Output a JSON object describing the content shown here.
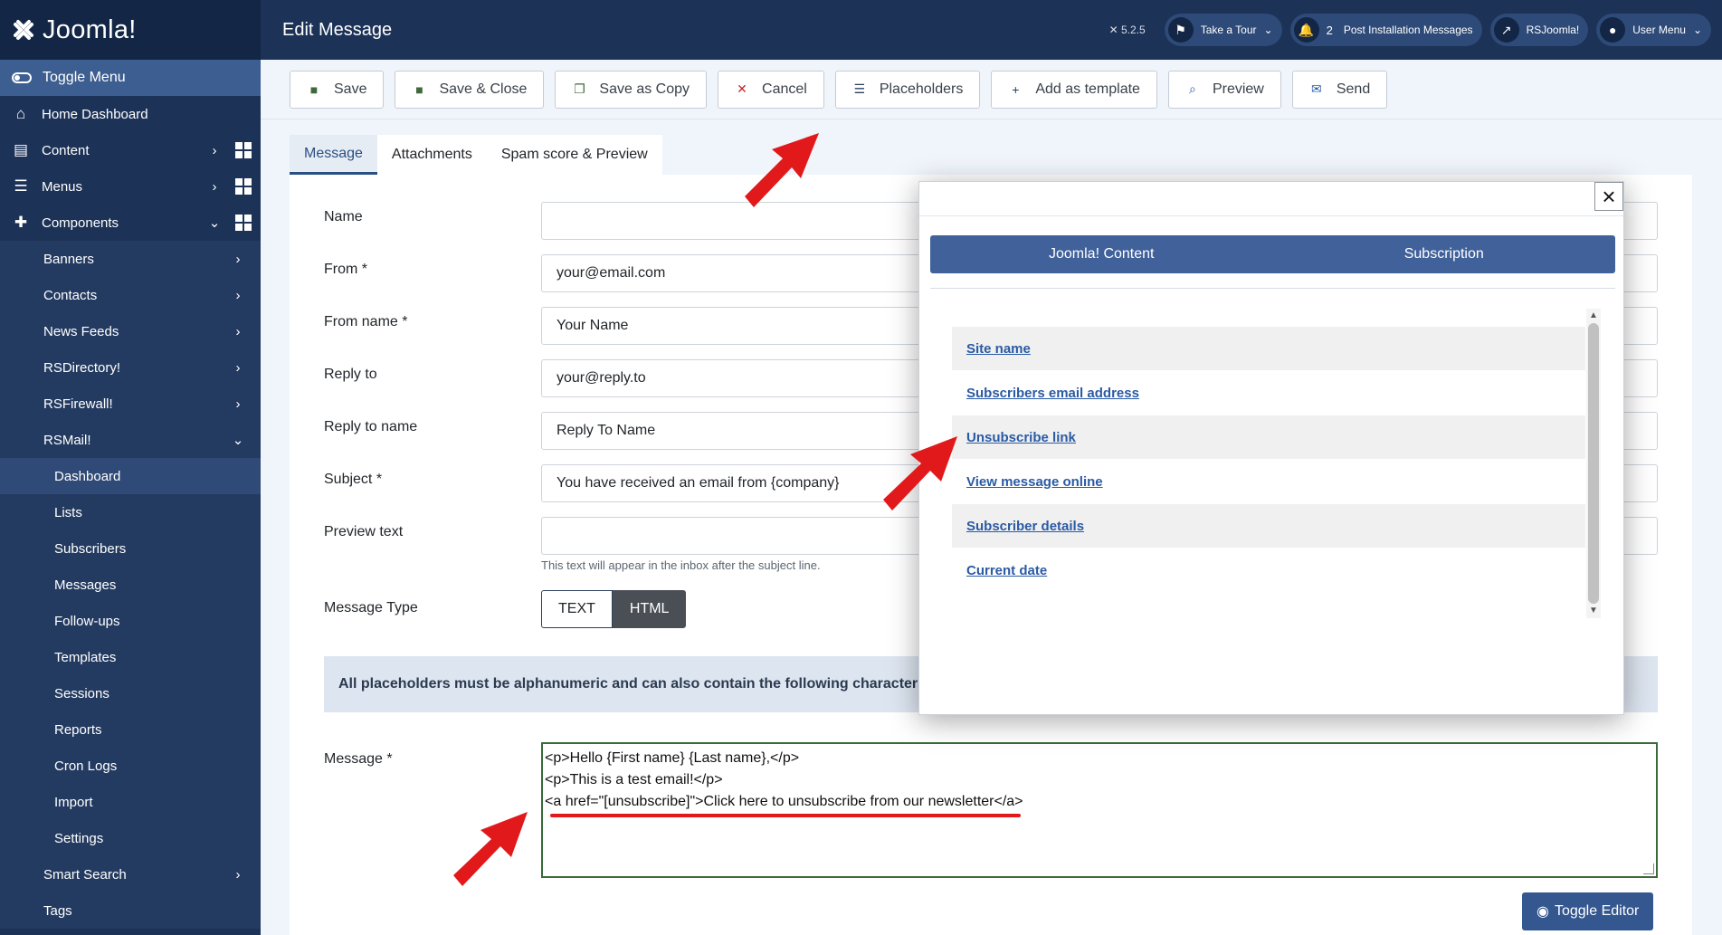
{
  "brand": {
    "name": "Joomla!"
  },
  "sidebar": {
    "toggle": "Toggle Menu",
    "items": [
      {
        "label": "Home Dashboard",
        "icon": "home-icon"
      },
      {
        "label": "Content",
        "icon": "file-icon"
      },
      {
        "label": "Menus",
        "icon": "list-icon"
      },
      {
        "label": "Components",
        "icon": "puzzle-icon"
      }
    ],
    "components": [
      "Banners",
      "Contacts",
      "News Feeds",
      "RSDirectory!",
      "RSFirewall!",
      "RSMail!"
    ],
    "rsmail": [
      "Dashboard",
      "Lists",
      "Subscribers",
      "Messages",
      "Follow-ups",
      "Templates",
      "Sessions",
      "Reports",
      "Cron Logs",
      "Import",
      "Settings"
    ],
    "after": [
      "Smart Search",
      "Tags"
    ]
  },
  "header": {
    "title": "Edit Message",
    "version": "5.2.5",
    "tour": "Take a Tour",
    "notifications_count": "2",
    "post_install": "Post Installation Messages",
    "site": "RSJoomla!",
    "user_menu": "User Menu"
  },
  "toolbar": {
    "save": "Save",
    "save_close": "Save & Close",
    "save_copy": "Save as Copy",
    "cancel": "Cancel",
    "placeholders": "Placeholders",
    "add_template": "Add as template",
    "preview": "Preview",
    "send": "Send"
  },
  "tabs": [
    "Message",
    "Attachments",
    "Spam score & Preview"
  ],
  "form": {
    "name_label": "Name",
    "name_value": "",
    "from_label": "From *",
    "from_value": "your@email.com",
    "from_name_label": "From name *",
    "from_name_value": "Your Name",
    "reply_to_label": "Reply to",
    "reply_to_value": "your@reply.to",
    "reply_to_name_label": "Reply to name",
    "reply_to_name_value": "Reply To Name",
    "subject_label": "Subject *",
    "subject_value": "You have received an email from {company}",
    "preview_text_label": "Preview text",
    "preview_text_value": "",
    "preview_help": "This text will appear in the inbox after the subject line.",
    "message_type_label": "Message Type",
    "type_text": "TEXT",
    "type_html": "HTML",
    "info": "All placeholders must be alphanumeric and can also contain the following characters: spa",
    "message_label": "Message *",
    "message_lines": [
      "<p>Hello {First name} {Last name},</p>",
      "<p>This is a test email!</p>",
      "<a href=\"[unsubscribe]\">Click here to unsubscribe from our newsletter</a>"
    ],
    "toggle_editor": "Toggle Editor"
  },
  "modal": {
    "close": "×",
    "tabs": [
      "Joomla! Content",
      "Subscription"
    ],
    "placeholders": [
      "Site name",
      "Subscribers email address",
      "Unsubscribe link",
      "View message online",
      "Subscriber details",
      "Current date"
    ]
  },
  "colors": {
    "sidebar": "#1c3257",
    "accent": "#40619a",
    "annotation": "#e2191b"
  }
}
